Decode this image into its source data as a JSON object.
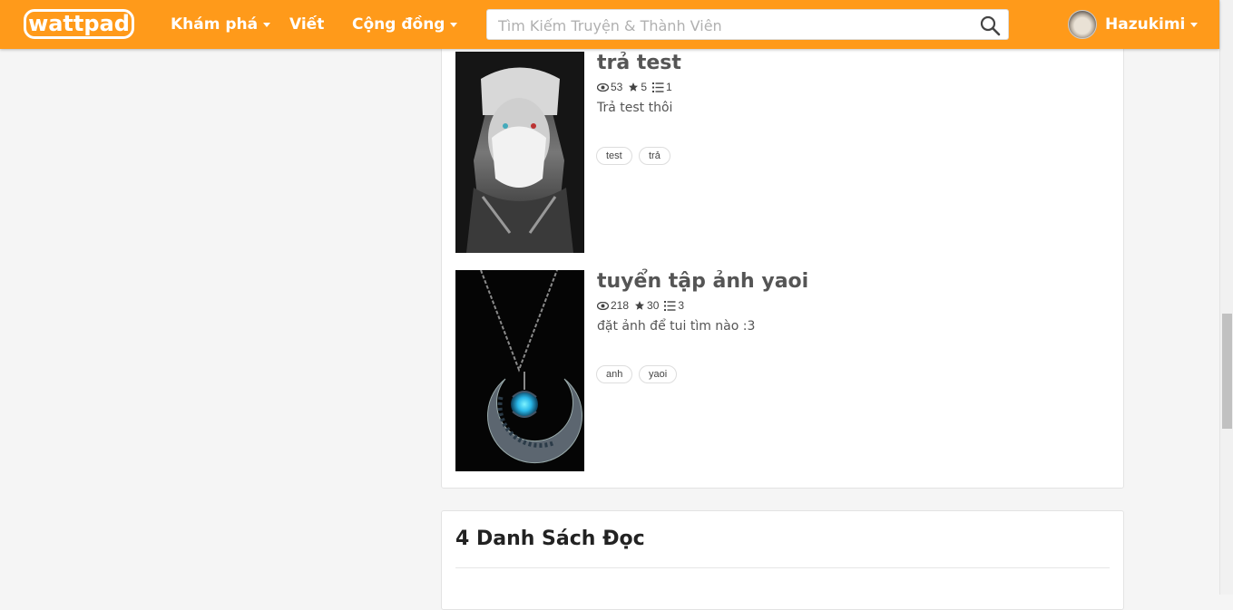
{
  "nav": {
    "logo": "wattpad",
    "items": [
      {
        "label": "Khám phá",
        "has_caret": true
      },
      {
        "label": "Viết",
        "has_caret": false
      },
      {
        "label": "Cộng đồng",
        "has_caret": true
      }
    ],
    "search": {
      "placeholder": "Tìm Kiếm Truyện & Thành Viên",
      "value": ""
    },
    "user": {
      "name": "Hazukimi"
    }
  },
  "stories": [
    {
      "title": "trả test",
      "views": "53",
      "votes": "5",
      "parts": "1",
      "description": "Trả test thôi",
      "tags": [
        "test",
        "trả"
      ]
    },
    {
      "title": "tuyển tập ảnh yaoi",
      "views": "218",
      "votes": "30",
      "parts": "3",
      "description": "đặt ảnh để tui tìm nào :3",
      "tags": [
        "anh",
        "yaoi"
      ]
    }
  ],
  "reading_lists": {
    "title": "4 Danh Sách Đọc"
  },
  "colors": {
    "brand": "#ff9a1a",
    "title_text": "#555555"
  }
}
